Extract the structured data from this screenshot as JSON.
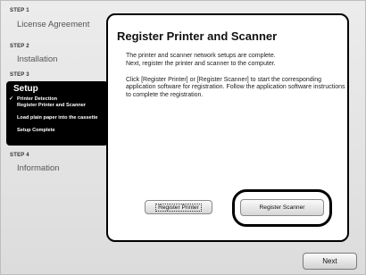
{
  "sidebar": {
    "step1": {
      "num": "STEP 1",
      "label": "License Agreement"
    },
    "step2": {
      "num": "STEP 2",
      "label": "Installation"
    },
    "step3": {
      "num": "STEP 3",
      "label": "Setup",
      "items": [
        {
          "label": "Printer Detection",
          "checked": true
        },
        {
          "label": "Register Printer and Scanner",
          "checked": false
        },
        {
          "label": "Load plain paper into the cassette",
          "checked": false
        },
        {
          "label": "Setup Complete",
          "checked": false
        }
      ],
      "check_glyph": "✓"
    },
    "step4": {
      "num": "STEP 4",
      "label": "Information"
    }
  },
  "main": {
    "title": "Register Printer and Scanner",
    "paragraph1_line1": "The printer and scanner network setups are complete.",
    "paragraph1_line2": "Next, register the printer and scanner to the computer.",
    "paragraph2": "Click [Register Printer] or [Register Scanner] to start the corresponding application software for registration. Follow the application software instructions to complete the registration.",
    "register_printer_label": "Register Printer",
    "register_scanner_label": "Register Scanner"
  },
  "footer": {
    "next_label": "Next"
  }
}
